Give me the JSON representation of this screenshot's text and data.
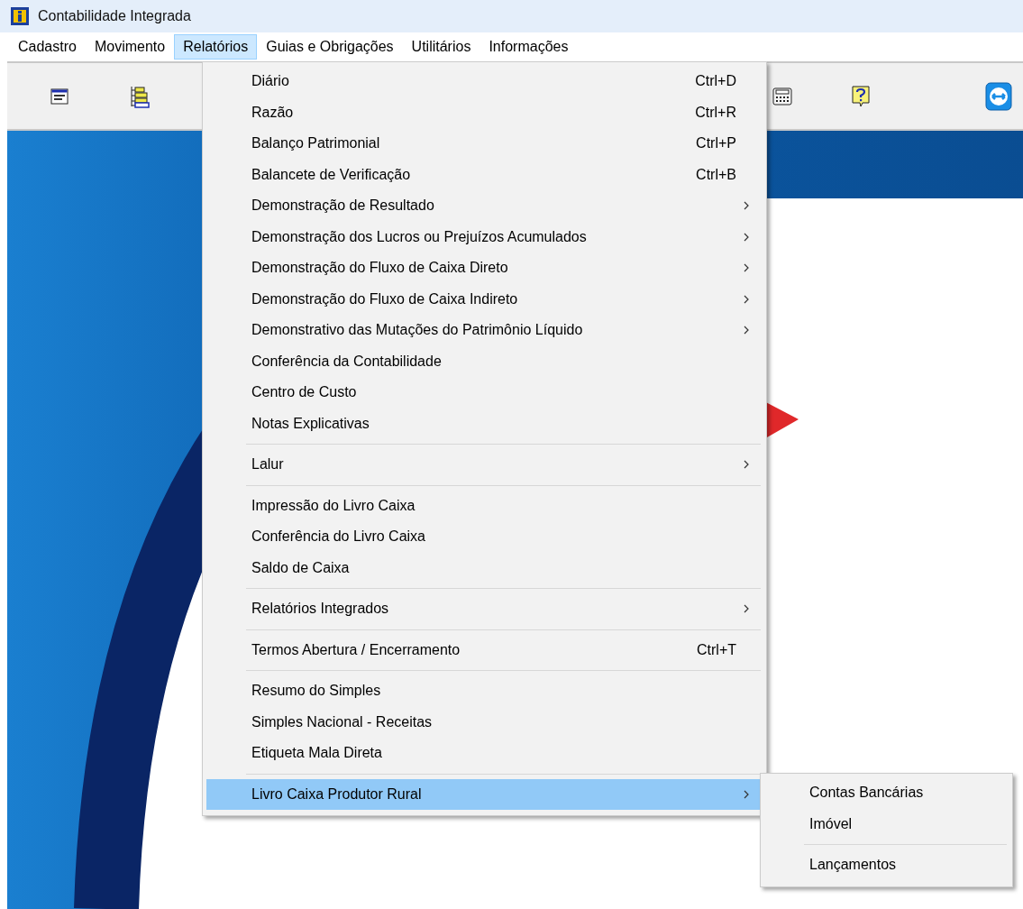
{
  "window": {
    "title": "Contabilidade Integrada"
  },
  "menu_bar": [
    {
      "label": "Cadastro",
      "selected": false
    },
    {
      "label": "Movimento",
      "selected": false
    },
    {
      "label": "Relatórios",
      "selected": true
    },
    {
      "label": "Guias e Obrigações",
      "selected": false
    },
    {
      "label": "Utilitários",
      "selected": false
    },
    {
      "label": "Informações",
      "selected": false
    }
  ],
  "dropdown": {
    "groups": [
      [
        {
          "label": "Diário",
          "shortcut": "Ctrl+D",
          "submenu": false,
          "selected": false
        },
        {
          "label": "Razão",
          "shortcut": "Ctrl+R",
          "submenu": false,
          "selected": false
        },
        {
          "label": "Balanço Patrimonial",
          "shortcut": "Ctrl+P",
          "submenu": false,
          "selected": false
        },
        {
          "label": "Balancete de Verificação",
          "shortcut": "Ctrl+B",
          "submenu": false,
          "selected": false
        },
        {
          "label": "Demonstração de Resultado",
          "submenu": true,
          "selected": false
        },
        {
          "label": "Demonstração dos Lucros ou Prejuízos Acumulados",
          "submenu": true,
          "selected": false
        },
        {
          "label": "Demonstração do Fluxo de Caixa Direto",
          "submenu": true,
          "selected": false
        },
        {
          "label": "Demonstração do Fluxo de Caixa Indireto",
          "submenu": true,
          "selected": false
        },
        {
          "label": "Demonstrativo das Mutações do Patrimônio Líquido",
          "submenu": true,
          "selected": false
        },
        {
          "label": "Conferência da Contabilidade",
          "submenu": false,
          "selected": false
        },
        {
          "label": "Centro de Custo",
          "submenu": false,
          "selected": false
        },
        {
          "label": "Notas Explicativas",
          "submenu": false,
          "selected": false
        }
      ],
      [
        {
          "label": "Lalur",
          "submenu": true,
          "selected": false
        }
      ],
      [
        {
          "label": "Impressão do Livro Caixa",
          "submenu": false,
          "selected": false
        },
        {
          "label": "Conferência do Livro Caixa",
          "submenu": false,
          "selected": false
        },
        {
          "label": "Saldo de Caixa",
          "submenu": false,
          "selected": false
        }
      ],
      [
        {
          "label": "Relatórios Integrados",
          "submenu": true,
          "selected": false
        }
      ],
      [
        {
          "label": "Termos Abertura / Encerramento",
          "shortcut": "Ctrl+T",
          "submenu": false,
          "selected": false
        }
      ],
      [
        {
          "label": "Resumo do Simples",
          "submenu": false,
          "selected": false
        },
        {
          "label": "Simples Nacional - Receitas",
          "submenu": false,
          "selected": false
        },
        {
          "label": "Etiqueta Mala Direta",
          "submenu": false,
          "selected": false
        }
      ],
      [
        {
          "label": "Livro Caixa Produtor Rural",
          "submenu": true,
          "selected": true
        }
      ]
    ]
  },
  "submenu": {
    "groups": [
      [
        {
          "label": "Contas Bancárias"
        },
        {
          "label": "Imóvel"
        }
      ],
      [
        {
          "label": "Lançamentos"
        }
      ]
    ]
  }
}
